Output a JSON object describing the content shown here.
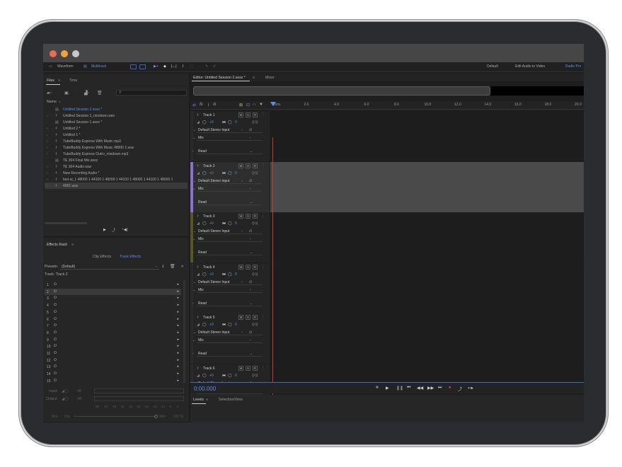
{
  "toolbar": {
    "waveform": "Waveform",
    "multitrack": "Multitrack",
    "workspace": [
      "Default",
      "Edit Audio to Video",
      "Radio Pro"
    ]
  },
  "files_panel": {
    "tabs": [
      "Files",
      "Time"
    ],
    "name_header": "Name",
    "items": [
      "Untitled Session 2.sesx *",
      "Untitled Session 1_mixdown.wav",
      "Untitled Session 1.sesx *",
      "Untitled 2 *",
      "Untitled 1 *",
      "TubeBuddy Express With Music.mp3",
      "TubeBuddy Express With Music 48000 1.wav",
      "TubeBuddy Express Outro_mixdown.mp3",
      "TE 304 Final Mix.sesx",
      "TE 304 Audio.wav",
      "New Recording Audio *",
      "fast-ai_1 48000 1 44100 1 48000 1 44100 1 48000 1 44100 1 48000 1",
      "4061.wav"
    ]
  },
  "effects_rack": {
    "title": "Effects Rack",
    "tabs": [
      "Clip Effects",
      "Track Effects"
    ],
    "presets_label": "Presets:",
    "presets_value": "(Default)",
    "track_label": "Track: Track 2",
    "slots": [
      "1",
      "2",
      "3",
      "4",
      "5",
      "6",
      "7",
      "8",
      "9",
      "10",
      "11",
      "12",
      "13",
      "14",
      "15"
    ],
    "input_label": "Input",
    "output_label": "Output",
    "input_value": "+0",
    "output_value": "+0",
    "meter_scale": [
      "dB",
      "-54",
      "-48",
      "-42",
      "-36",
      "-30",
      "-24",
      "-18",
      "-12",
      "-6",
      "0"
    ],
    "mix_label": "Mix:",
    "dry_label": "Dry",
    "wet_label": "Wet",
    "wet_value": "100 %"
  },
  "editor": {
    "tab_title": "Editor: Untitled Session 2.sesx *",
    "mixer_tab": "Mixer",
    "ruler": [
      "hms",
      "2.0",
      "4.0",
      "6.0",
      "8.0",
      "10.0",
      "12.0",
      "14.0",
      "16.0",
      "18.0",
      "20.0"
    ],
    "tracks": [
      {
        "name": "Track 1",
        "input": "Default Stereo Input",
        "mix": "Mix",
        "mode": "Read",
        "color": "#2a2a2a"
      },
      {
        "name": "Track 2",
        "input": "Default Stereo Input",
        "mix": "Mix",
        "mode": "Read",
        "color": "#8d6fd4"
      },
      {
        "name": "Track 3",
        "input": "Default Stereo Input",
        "mix": "Mix",
        "mode": "Read",
        "color": "#5a5324"
      },
      {
        "name": "Track 4",
        "input": "Default Stereo Input",
        "mix": "Mix",
        "mode": "Read",
        "color": "#2a2a2a"
      },
      {
        "name": "Track 5",
        "input": "Default Stereo Input",
        "mix": "Mix",
        "mode": "Read",
        "color": "#2a2a2a"
      },
      {
        "name": "Track 6",
        "input": "Default Stereo Input",
        "mix": "Mix",
        "mode": "Read",
        "color": "#2a2a2a"
      }
    ],
    "volume_value": "+0",
    "pan_value": "0",
    "msr": [
      "M",
      "S",
      "R"
    ]
  },
  "transport": {
    "time": "0:00.000"
  },
  "levels_panel": {
    "tabs": [
      "Levels",
      "Selection/View"
    ]
  }
}
